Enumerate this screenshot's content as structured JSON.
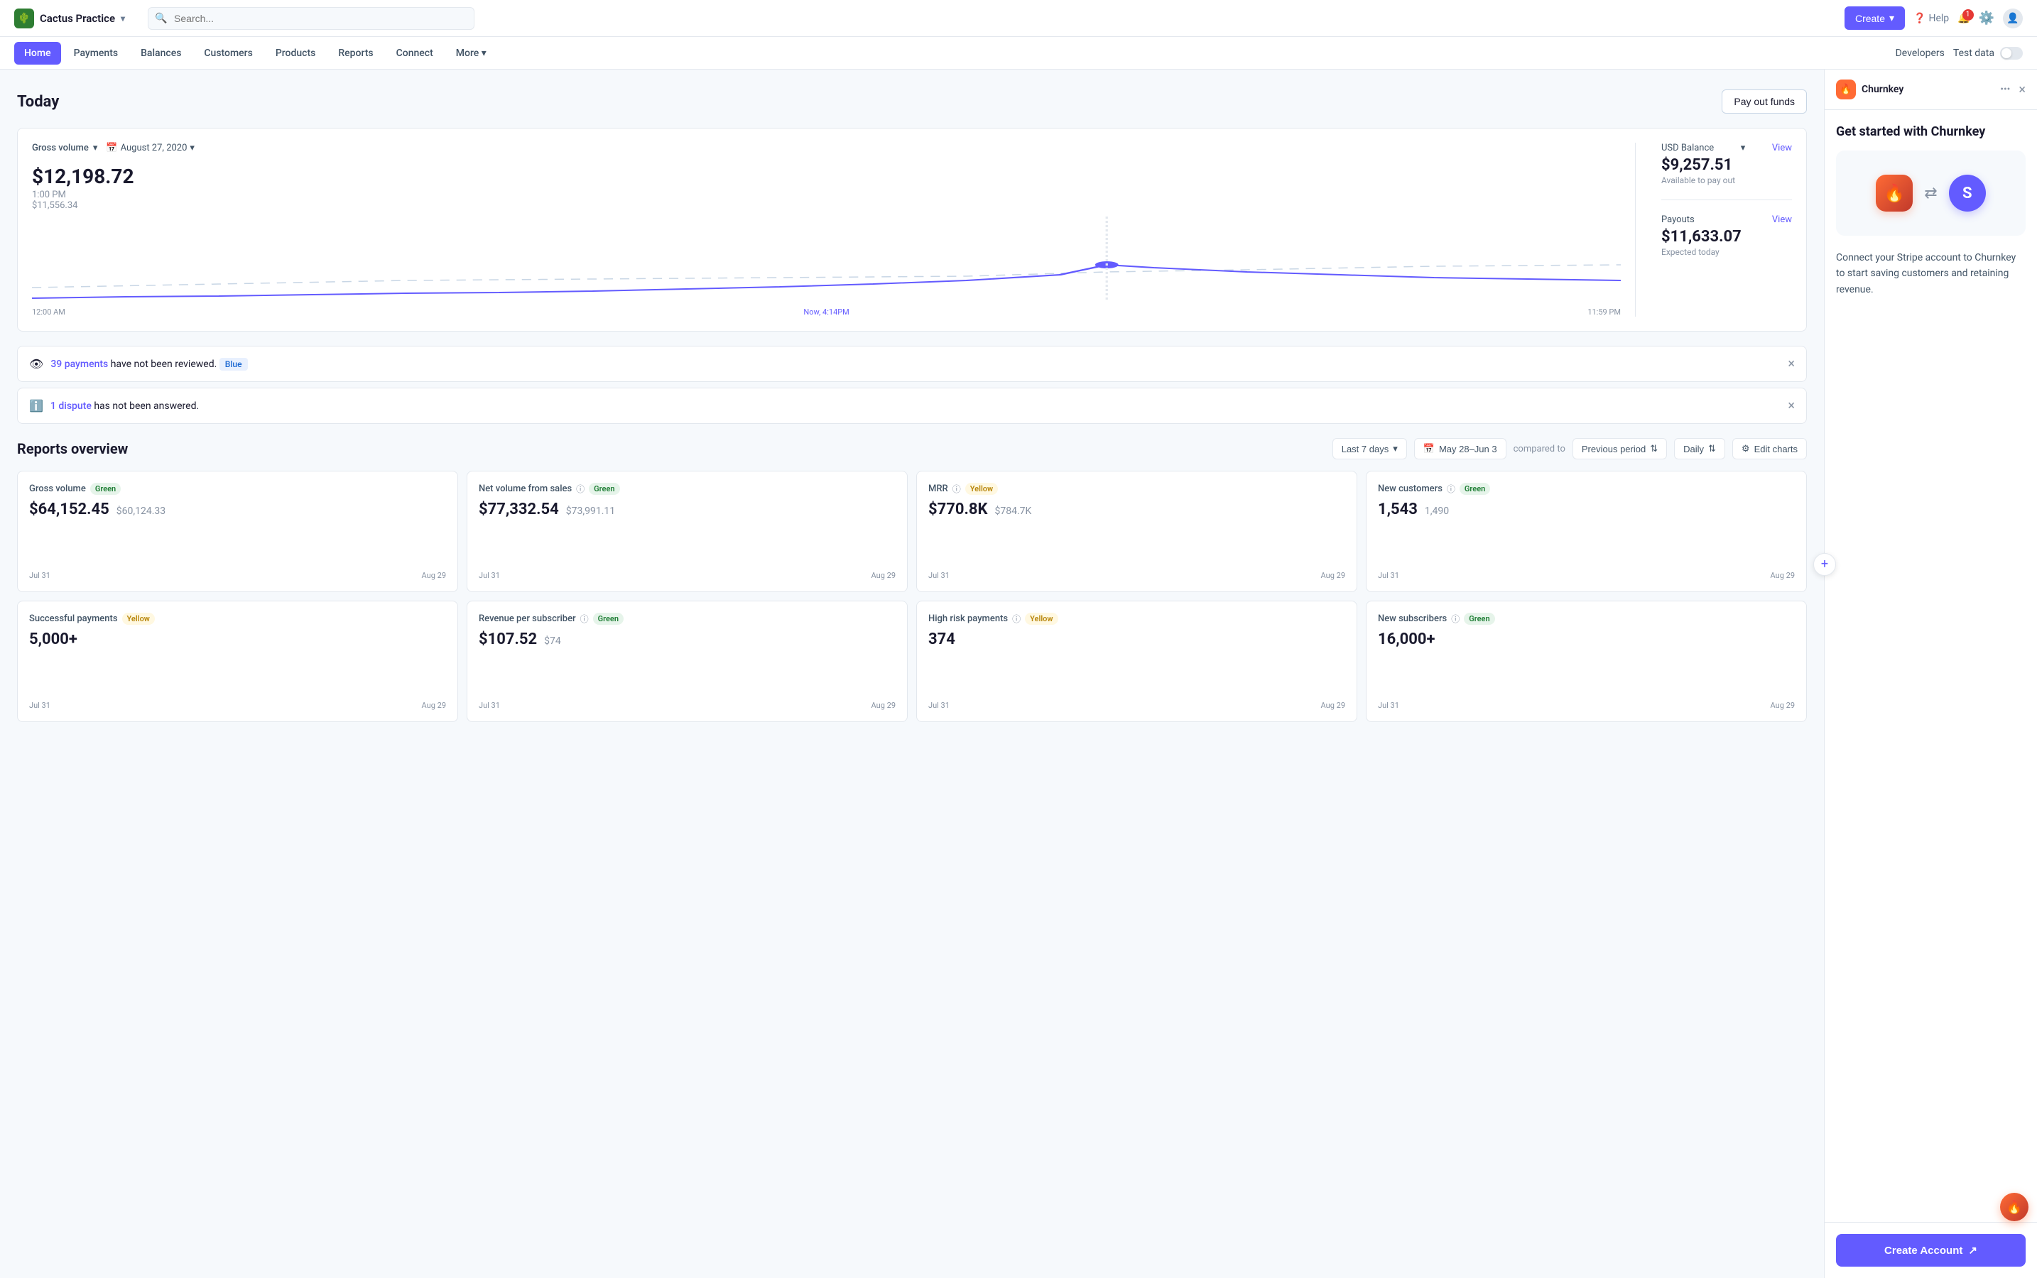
{
  "brand": {
    "name": "Cactus Practice",
    "chevron": "▾"
  },
  "search": {
    "placeholder": "Search..."
  },
  "nav": {
    "create_label": "Create",
    "help_label": "Help",
    "notification_count": "1"
  },
  "sub_nav": {
    "items": [
      {
        "label": "Home",
        "active": true
      },
      {
        "label": "Payments"
      },
      {
        "label": "Balances"
      },
      {
        "label": "Customers"
      },
      {
        "label": "Products"
      },
      {
        "label": "Reports"
      },
      {
        "label": "Connect"
      },
      {
        "label": "More"
      }
    ],
    "developers": "Developers",
    "test_data": "Test data"
  },
  "today": {
    "title": "Today",
    "pay_out_label": "Pay out funds"
  },
  "chart": {
    "gross_volume_label": "Gross volume",
    "date_label": "August 27, 2020",
    "amount": "$12,198.72",
    "time": "1:00 PM",
    "compare_amount": "$11,556.34",
    "time_start": "12:00 AM",
    "time_now": "Now, 4:14PM",
    "time_end": "11:59 PM"
  },
  "balance": {
    "usd_label": "USD Balance",
    "view1": "View",
    "amount1": "$9,257.51",
    "avail": "Available to pay out",
    "payouts_label": "Payouts",
    "view2": "View",
    "amount2": "$11,633.07",
    "expected": "Expected today"
  },
  "alerts": [
    {
      "type": "warning",
      "link_text": "39 payments",
      "rest": " have not been reviewed.",
      "badge": "Blue"
    },
    {
      "type": "info",
      "link_text": "1 dispute",
      "rest": " has not been answered."
    }
  ],
  "reports": {
    "title": "Reports overview",
    "date_range": "Last 7 days",
    "date_display": "May 28–Jun 3",
    "compared_to": "compared to",
    "prev_period": "Previous period",
    "daily": "Daily",
    "edit_charts": "Edit charts"
  },
  "metrics": [
    {
      "label": "Gross volume",
      "tag": "Green",
      "tag_type": "green",
      "main": "$64,152.45",
      "compare": "$60,124.33",
      "date_start": "Jul 31",
      "date_end": "Aug 29"
    },
    {
      "label": "Net volume from sales",
      "tag": "Green",
      "tag_type": "green",
      "info": true,
      "main": "$77,332.54",
      "compare": "$73,991.11",
      "date_start": "Jul 31",
      "date_end": "Aug 29"
    },
    {
      "label": "MRR",
      "tag": "Yellow",
      "tag_type": "yellow",
      "info": true,
      "main": "$770.8K",
      "compare": "$784.7K",
      "date_start": "Jul 31",
      "date_end": "Aug 29"
    },
    {
      "label": "New customers",
      "tag": "Green",
      "tag_type": "green",
      "info": true,
      "main": "1,543",
      "compare": "1,490",
      "date_start": "Jul 31",
      "date_end": "Aug 29"
    },
    {
      "label": "Successful payments",
      "tag": "Yellow",
      "tag_type": "yellow",
      "main": "5,000+",
      "compare": "",
      "date_start": "Jul 31",
      "date_end": "Aug 29"
    },
    {
      "label": "Revenue per subscriber",
      "tag": "Green",
      "tag_type": "green",
      "info": true,
      "main": "$107.52",
      "compare": "$74",
      "date_start": "Jul 31",
      "date_end": "Aug 29"
    },
    {
      "label": "High risk payments",
      "tag": "Yellow",
      "tag_type": "yellow",
      "info": true,
      "main": "374",
      "compare": "",
      "date_start": "Jul 31",
      "date_end": "Aug 29"
    },
    {
      "label": "New subscribers",
      "tag": "Green",
      "tag_type": "green",
      "info": true,
      "main": "16,000+",
      "compare": "",
      "date_start": "Jul 31",
      "date_end": "Aug 29"
    }
  ],
  "side_panel": {
    "title": "Churnkey",
    "heading": "Get started with Churnkey",
    "description": "Connect your Stripe account to Churnkey to start saving customers and retaining revenue.",
    "create_account": "Create Account"
  }
}
